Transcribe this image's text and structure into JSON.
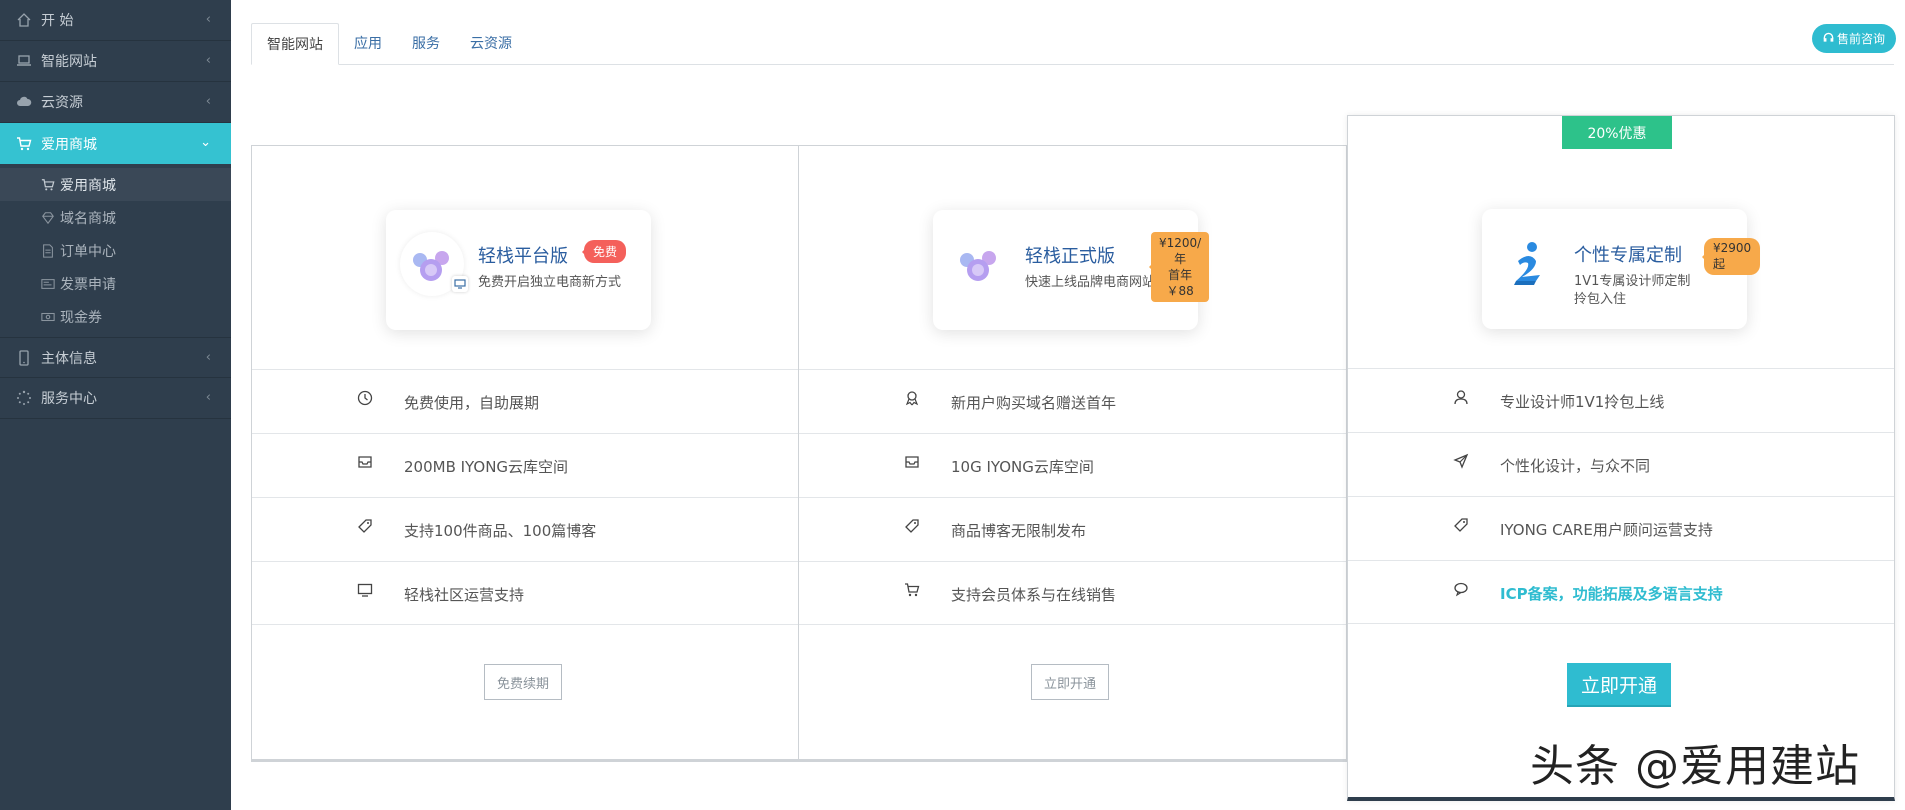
{
  "sidebar": {
    "items": [
      {
        "label": "开 始",
        "icon": "home-icon"
      },
      {
        "label": "智能网站",
        "icon": "laptop-icon"
      },
      {
        "label": "云资源",
        "icon": "cloud-icon"
      },
      {
        "label": "爱用商城",
        "icon": "cart-icon",
        "active": true
      },
      {
        "label": "主体信息",
        "icon": "phone-icon"
      },
      {
        "label": "服务中心",
        "icon": "spinner-icon"
      }
    ],
    "sub_items": [
      {
        "label": "爱用商城",
        "icon": "cart-icon",
        "active": true
      },
      {
        "label": "域名商城",
        "icon": "diamond-icon"
      },
      {
        "label": "订单中心",
        "icon": "document-icon"
      },
      {
        "label": "发票申请",
        "icon": "invoice-icon"
      },
      {
        "label": "现金券",
        "icon": "coupon-icon"
      }
    ]
  },
  "tabs": [
    {
      "label": "智能网站",
      "active": true
    },
    {
      "label": "应用"
    },
    {
      "label": "服务"
    },
    {
      "label": "云资源"
    }
  ],
  "consult_button": "售前咨询",
  "discount_badge": "20%优惠",
  "plans": [
    {
      "title": "轻栈平台版",
      "subtitle": "免费开启独立电商新方式",
      "tag": "免费",
      "features": [
        {
          "icon": "clock-icon",
          "text": "免费使用，自助展期"
        },
        {
          "icon": "inbox-icon",
          "text": "200MB IYONG云库空间"
        },
        {
          "icon": "tag-icon",
          "text": "支持100件商品、100篇博客"
        },
        {
          "icon": "monitor-icon",
          "text": "轻栈社区运营支持"
        }
      ],
      "button": "免费续期"
    },
    {
      "title": "轻栈正式版",
      "subtitle": "快速上线品牌电商网站",
      "tag_line1": "¥1200/年",
      "tag_line2": "首年￥88",
      "features": [
        {
          "icon": "award-icon",
          "text": "新用户购买域名赠送首年"
        },
        {
          "icon": "inbox-icon",
          "text": "10G IYONG云库空间"
        },
        {
          "icon": "tag-icon",
          "text": "商品博客无限制发布"
        },
        {
          "icon": "cart-icon",
          "text": "支持会员体系与在线销售"
        }
      ],
      "button": "立即开通"
    },
    {
      "title": "个性专属定制",
      "subtitle_line1": "1V1专属设计师定制",
      "subtitle_line2": "拎包入住",
      "tag": "¥2900起",
      "features": [
        {
          "icon": "user-icon",
          "text": "专业设计师1V1拎包上线"
        },
        {
          "icon": "rocket-icon",
          "text": "个性化设计，与众不同"
        },
        {
          "icon": "tag-icon",
          "text": "IYONG CARE用户顾问运营支持"
        },
        {
          "icon": "chat-icon",
          "text": "ICP备案，功能拓展及多语言支持",
          "highlight": true
        }
      ],
      "button": "立即开通"
    }
  ],
  "watermark": "头条 @爱用建站",
  "colors": {
    "sidebar_bg": "#2f3e4d",
    "accent": "#35c2d1",
    "discount": "#2dc28a",
    "tag_red": "#f4605b",
    "tag_orange": "#f7a94a"
  }
}
